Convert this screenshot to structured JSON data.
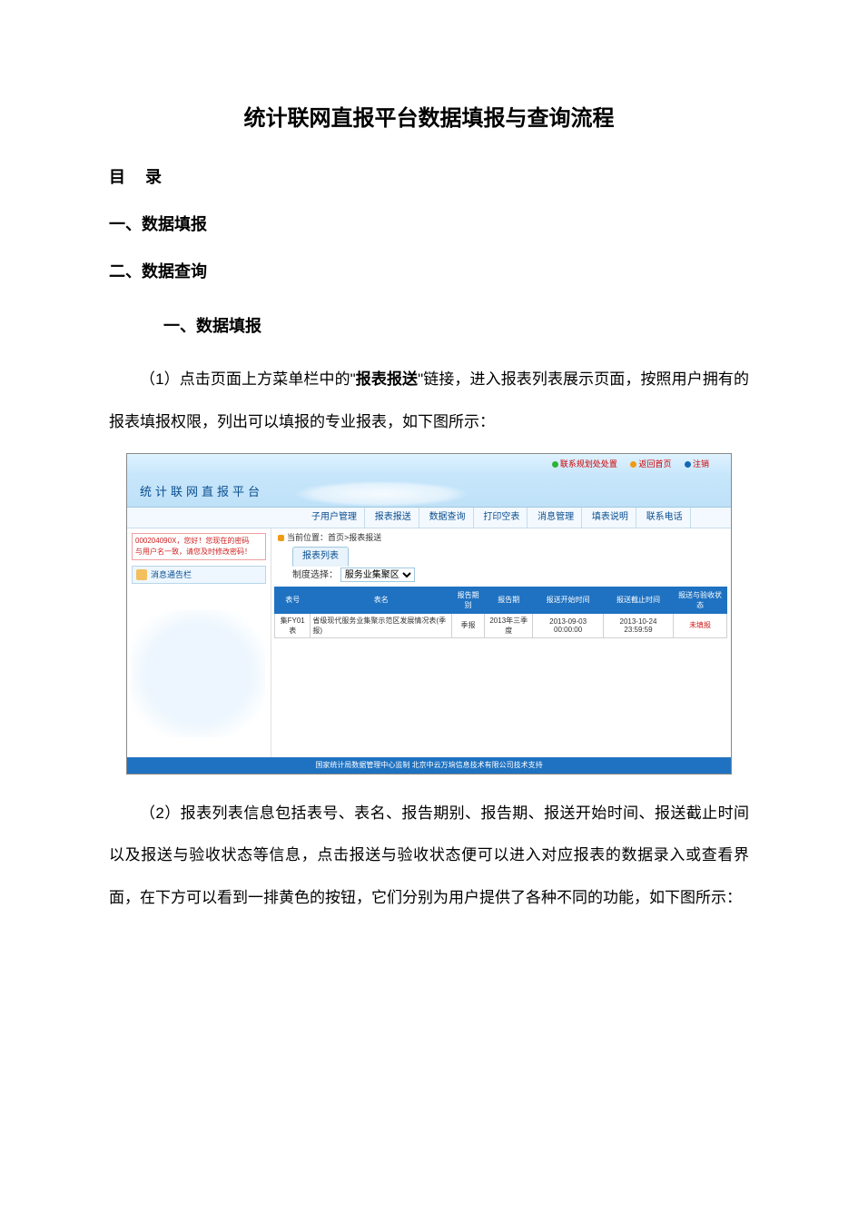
{
  "title": "统计联网直报平台数据填报与查询流程",
  "toc": {
    "heading": "目录",
    "item1": "一、数据填报",
    "item2": "二、数据查询"
  },
  "section1": {
    "heading": "一、数据填报",
    "p1_a": "（1）点击页面上方菜单栏中的\"",
    "p1_bold": "报表报送",
    "p1_b": "\"链接，进入报表列表展示页面，按照用户拥有的报表填报权限，列出可以填报的专业报表，如下图所示：",
    "p2": "（2）报表列表信息包括表号、表名、报告期别、报告期、报送开始时间、报送截止时间以及报送与验收状态等信息，点击报送与验收状态便可以进入对应报表的数据录入或查看界面，在下方可以看到一排黄色的按钮，它们分别为用户提供了各种不同的功能，如下图所示："
  },
  "screenshot1": {
    "platform_name": "统计联网直报平台",
    "top_links": {
      "a": "联系规划处处置",
      "b": "返回首页",
      "c": "注销"
    },
    "menu": {
      "m1": "子用户管理",
      "m2": "报表报送",
      "m3": "数据查询",
      "m4": "打印空表",
      "m5": "消息管理",
      "m6": "填表说明",
      "m7": "联系电话"
    },
    "notice_line1": "000204090X，您好！您现在的密码",
    "notice_line2": "与用户名一致，请您及时修改密码！",
    "msg_panel": "消息通告栏",
    "crumb": "当前位置：首页>报表报送",
    "tab_btn": "报表列表",
    "select_label": "制度选择：",
    "select_value": "服务业集聚区",
    "table": {
      "headers": {
        "h1": "表号",
        "h2": "表名",
        "h3": "报告期别",
        "h4": "报告期",
        "h5": "报送开始时间",
        "h6": "报送截止时间",
        "h7": "报送与验收状态"
      },
      "row1": {
        "c1": "集FY01表",
        "c2": "省级现代服务业集聚示范区发展情况表(季报)",
        "c3": "季报",
        "c4": "2013年三季度",
        "c5": "2013-09-03 00:00:00",
        "c6": "2013-10-24 23:59:59",
        "c7": "未填报"
      }
    },
    "footer": "国家统计局数据管理中心监制 北京中云万垧信息技术有限公司技术支持"
  }
}
